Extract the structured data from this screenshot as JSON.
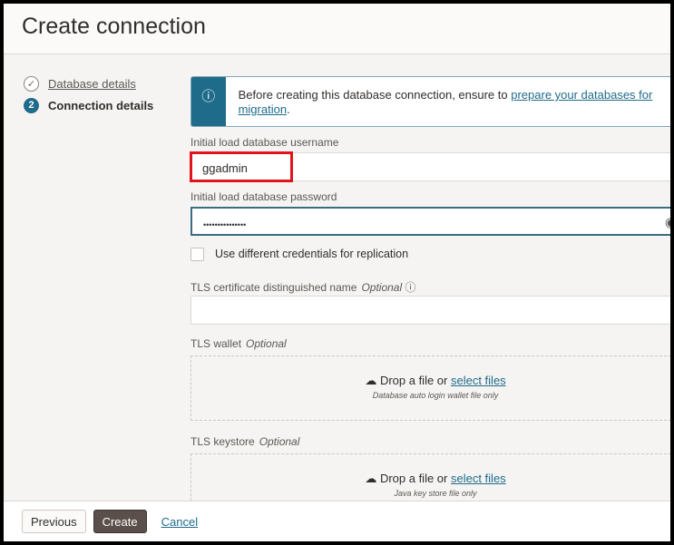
{
  "title": "Create connection",
  "steps": [
    {
      "label": "Database details",
      "state": "done"
    },
    {
      "label": "Connection details",
      "number": "2",
      "state": "current"
    }
  ],
  "info": {
    "text": "Before creating this database connection, ensure to ",
    "link": "prepare your databases for migration",
    "suffix": "."
  },
  "fields": {
    "username": {
      "label": "Initial load database username",
      "value": "ggadmin"
    },
    "password": {
      "label": "Initial load database password",
      "value": "•••••••••••••••"
    },
    "different_creds": {
      "label": "Use different credentials for replication",
      "checked": false
    },
    "tls_dn": {
      "label": "TLS certificate distinguished name",
      "optional": "Optional",
      "value": ""
    },
    "tls_wallet": {
      "label": "TLS wallet",
      "optional": "Optional",
      "drop": "Drop a file or ",
      "select": "select files",
      "hint": "Database auto login wallet file only"
    },
    "tls_keystore": {
      "label": "TLS keystore",
      "optional": "Optional",
      "drop": "Drop a file or ",
      "select": "select files",
      "hint": "Java key store file only"
    }
  },
  "footer": {
    "previous": "Previous",
    "create": "Create",
    "cancel": "Cancel"
  },
  "colors": {
    "accent": "#1f6b8a",
    "highlight": "#e1141e",
    "primary_button": "#5a4f4b"
  }
}
